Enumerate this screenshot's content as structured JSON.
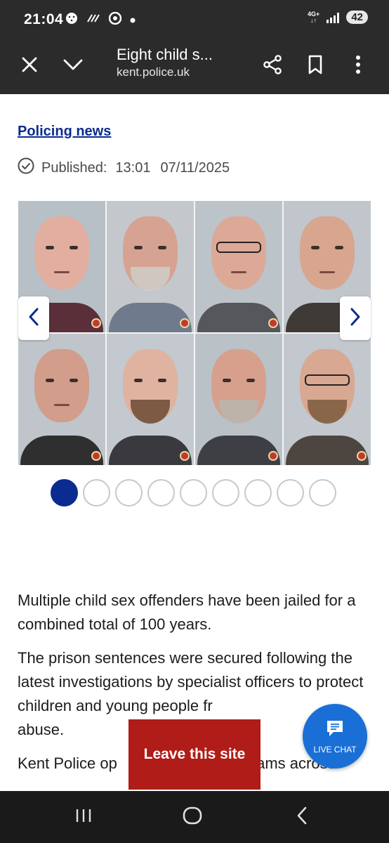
{
  "status_bar": {
    "time": "21:04",
    "network": "4G+",
    "battery": "42",
    "icons": [
      "notification-icon",
      "wifi-calling-icon",
      "chrome-icon",
      "dot-icon"
    ]
  },
  "toolbar": {
    "title": "Eight child s...",
    "domain": "kent.police.uk",
    "icons": [
      "close-icon",
      "chevron-down-icon",
      "share-icon",
      "bookmark-icon",
      "more-vert-icon"
    ]
  },
  "article_meta": {
    "category_link": "Policing news",
    "published_label": "Published:",
    "published_time": "13:01",
    "published_date": "07/11/2025"
  },
  "gallery": {
    "slides_total": 9,
    "active_slide": 1,
    "photo_count": 8
  },
  "article": {
    "paragraphs": [
      "Multiple child sex offenders have been jailed for a combined total of 100 years.",
      "The prison sentences were secured following the latest investigations by specialist officers to protect children and young people fr",
      "Kent Police op"
    ],
    "para2_tail": "abuse.",
    "para3_tail": "eams across"
  },
  "overlays": {
    "leave_site": "Leave this site",
    "live_chat": "LIVE CHAT"
  },
  "colors": {
    "link": "#0a2b8f",
    "leave_button": "#b01c17",
    "chat_button": "#1a6fd6",
    "toolbar": "#2b2b2b"
  }
}
